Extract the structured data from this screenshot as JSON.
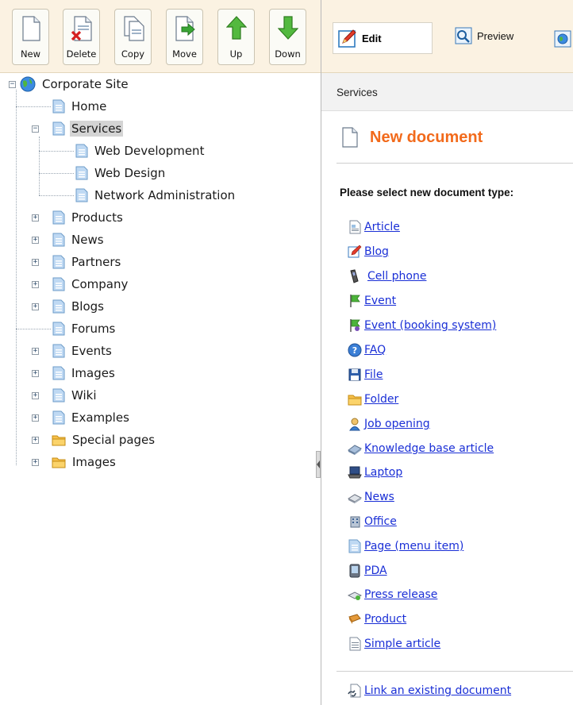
{
  "toolbar": {
    "new": "New",
    "delete": "Delete",
    "copy": "Copy",
    "move": "Move",
    "up": "Up",
    "down": "Down"
  },
  "view_modes": {
    "edit": "Edit",
    "preview": "Preview"
  },
  "tree": {
    "root": "Corporate Site",
    "items": [
      "Home",
      "Services",
      "Web Development",
      "Web Design",
      "Network Administration",
      "Products",
      "News",
      "Partners",
      "Company",
      "Blogs",
      "Forums",
      "Events",
      "Images",
      "Wiki",
      "Examples",
      "Special pages",
      "Images"
    ],
    "selected": "Services"
  },
  "breadcrumb": "Services",
  "page": {
    "title": "New document",
    "prompt": "Please select new document type:"
  },
  "document_types": [
    "Article",
    "Blog",
    "Cell phone",
    "Event",
    "Event (booking system)",
    "FAQ",
    "File",
    "Folder",
    "Job opening",
    "Knowledge base article",
    "Laptop",
    "News",
    "Office",
    "Page (menu item)",
    "PDA",
    "Press release",
    "Product",
    "Simple article"
  ],
  "link_existing": "Link an existing document",
  "colors": {
    "toolbar_bg": "#fbf2e2",
    "title_orange": "#f26a1b",
    "link_blue": "#1a2fd6",
    "selected_bg": "#d4d4d4"
  }
}
